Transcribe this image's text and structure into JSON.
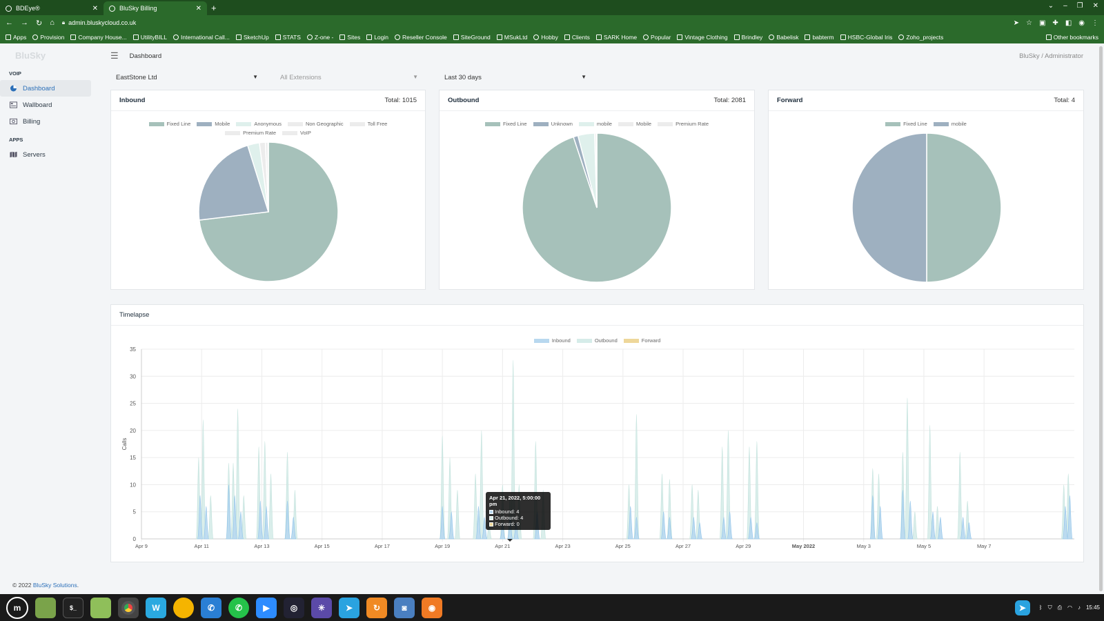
{
  "browser": {
    "tabs": [
      {
        "title": "BDEye®"
      },
      {
        "title": "BluSky Billing"
      }
    ],
    "address": "admin.bluskycloud.co.uk",
    "bookmarks": [
      "Apps",
      "Provision",
      "Company House...",
      "UtilityBILL",
      "International Call...",
      "SketchUp",
      "STATS",
      "Z-one -",
      "Sites",
      "Login",
      "Reseller Console",
      "SiteGround",
      "MSukLtd",
      "Hobby",
      "Clients",
      "SARK Home",
      "Popular",
      "Vintage Clothing",
      "Brindley",
      "Babelisk",
      "babterm",
      "HSBC-Global Iris",
      "Zoho_projects"
    ],
    "other_bookmarks": "Other bookmarks"
  },
  "sidebar": {
    "logo": "BluSky",
    "sections": [
      {
        "title": "VOIP",
        "items": [
          {
            "label": "Dashboard",
            "icon": "pie-chart-icon",
            "active": true
          },
          {
            "label": "Wallboard",
            "icon": "wallboard-icon",
            "active": false
          },
          {
            "label": "Billing",
            "icon": "billing-icon",
            "active": false
          }
        ]
      },
      {
        "title": "APPS",
        "items": [
          {
            "label": "Servers",
            "icon": "map-icon",
            "active": false
          }
        ]
      }
    ]
  },
  "header": {
    "breadcrumb": "Dashboard",
    "user": "BluSky / Administrator"
  },
  "filters": {
    "company": "EastStone Ltd",
    "extensions": "All Extensions",
    "period": "Last 30 days"
  },
  "cards": {
    "inbound": {
      "title": "Inbound",
      "total": "Total: 1015",
      "legend": [
        {
          "label": "Fixed Line",
          "color": "#a6c1ba"
        },
        {
          "label": "Mobile",
          "color": "#9eb0c0"
        },
        {
          "label": "Anonymous",
          "color": "#dff0ec"
        },
        {
          "label": "Non Geographic",
          "color": "#ececec"
        },
        {
          "label": "Toll Free",
          "color": "#ececec"
        },
        {
          "label": "Premium Rate",
          "color": "#ececec"
        },
        {
          "label": "VoIP",
          "color": "#ececec"
        }
      ]
    },
    "outbound": {
      "title": "Outbound",
      "total": "Total: 2081",
      "legend": [
        {
          "label": "Fixed Line",
          "color": "#a6c1ba"
        },
        {
          "label": "Unknown",
          "color": "#9eb0c0"
        },
        {
          "label": "mobile",
          "color": "#dff0ec"
        },
        {
          "label": "Mobile",
          "color": "#ececec"
        },
        {
          "label": "Premium Rate",
          "color": "#ececec"
        }
      ]
    },
    "forward": {
      "title": "Forward",
      "total": "Total: 4",
      "legend": [
        {
          "label": "Fixed Line",
          "color": "#a6c1ba"
        },
        {
          "label": "mobile",
          "color": "#9eb0c0"
        }
      ]
    }
  },
  "timelapse": {
    "title": "Timelapse",
    "legend": [
      {
        "label": "Inbound",
        "color": "#b8d8ef"
      },
      {
        "label": "Outbound",
        "color": "#d6ece9"
      },
      {
        "label": "Forward",
        "color": "#eed79a"
      }
    ],
    "tooltip": {
      "title": "Apr 21, 2022, 5:00:00 pm",
      "rows": [
        "Inbound: 4",
        "Outbound: 4",
        "Forward: 0"
      ]
    }
  },
  "chart_data": [
    {
      "type": "pie",
      "title": "Inbound",
      "labels": [
        "Fixed Line",
        "Mobile",
        "Anonymous",
        "Non Geographic",
        "Toll Free",
        "Premium Rate",
        "VoIP"
      ],
      "values": [
        742,
        224,
        28,
        14,
        6,
        1,
        0
      ]
    },
    {
      "type": "pie",
      "title": "Outbound",
      "labels": [
        "Fixed Line",
        "Unknown",
        "mobile",
        "Mobile",
        "Premium Rate"
      ],
      "values": [
        1975,
        21,
        75,
        8,
        2
      ]
    },
    {
      "type": "pie",
      "title": "Forward",
      "labels": [
        "Fixed Line",
        "mobile"
      ],
      "values": [
        2,
        2
      ]
    },
    {
      "type": "area",
      "title": "Timelapse",
      "ylabel": "Calls",
      "ylim": [
        0,
        35
      ],
      "yticks": [
        0,
        5,
        10,
        15,
        20,
        25,
        30,
        35
      ],
      "x_range": [
        "Apr 9",
        "May 9"
      ],
      "xticks": [
        {
          "label": "Apr 9",
          "day": 0,
          "bold": false
        },
        {
          "label": "Apr 11",
          "day": 2,
          "bold": false
        },
        {
          "label": "Apr 13",
          "day": 4,
          "bold": false
        },
        {
          "label": "Apr 15",
          "day": 6,
          "bold": false
        },
        {
          "label": "Apr 17",
          "day": 8,
          "bold": false
        },
        {
          "label": "Apr 19",
          "day": 10,
          "bold": false
        },
        {
          "label": "Apr 21",
          "day": 12,
          "bold": false
        },
        {
          "label": "Apr 23",
          "day": 14,
          "bold": false
        },
        {
          "label": "Apr 25",
          "day": 16,
          "bold": false
        },
        {
          "label": "Apr 27",
          "day": 18,
          "bold": false
        },
        {
          "label": "Apr 29",
          "day": 20,
          "bold": false
        },
        {
          "label": "May 2022",
          "day": 22,
          "bold": true
        },
        {
          "label": "May 3",
          "day": 24,
          "bold": false
        },
        {
          "label": "May 5",
          "day": 26,
          "bold": false
        },
        {
          "label": "May 7",
          "day": 28,
          "bold": false
        }
      ],
      "series": [
        {
          "name": "Outbound",
          "peaks": [
            [
              1.9,
              15
            ],
            [
              2.05,
              22
            ],
            [
              2.3,
              8
            ],
            [
              2.9,
              14
            ],
            [
              3.05,
              14
            ],
            [
              3.2,
              24
            ],
            [
              3.4,
              8
            ],
            [
              3.9,
              17
            ],
            [
              4.1,
              18
            ],
            [
              4.3,
              12
            ],
            [
              4.85,
              16
            ],
            [
              5.1,
              9
            ],
            [
              10.0,
              19
            ],
            [
              10.25,
              15
            ],
            [
              10.5,
              9
            ],
            [
              11.1,
              12
            ],
            [
              11.3,
              20
            ],
            [
              11.55,
              3
            ],
            [
              12.0,
              10
            ],
            [
              12.25,
              8
            ],
            [
              12.35,
              33
            ],
            [
              12.55,
              10
            ],
            [
              13.1,
              18
            ],
            [
              13.35,
              9
            ],
            [
              16.2,
              10
            ],
            [
              16.45,
              23
            ],
            [
              17.3,
              12
            ],
            [
              17.55,
              11
            ],
            [
              18.3,
              10
            ],
            [
              18.5,
              9
            ],
            [
              19.3,
              17
            ],
            [
              19.5,
              20
            ],
            [
              20.2,
              17
            ],
            [
              20.45,
              18
            ],
            [
              24.3,
              13
            ],
            [
              24.5,
              12
            ],
            [
              25.3,
              16
            ],
            [
              25.45,
              26
            ],
            [
              25.7,
              5
            ],
            [
              26.2,
              21
            ],
            [
              26.45,
              6
            ],
            [
              27.2,
              16
            ],
            [
              27.45,
              7
            ],
            [
              30.65,
              10
            ],
            [
              30.8,
              12
            ]
          ]
        },
        {
          "name": "Inbound",
          "peaks": [
            [
              1.95,
              8
            ],
            [
              2.15,
              6
            ],
            [
              2.9,
              10
            ],
            [
              3.1,
              8
            ],
            [
              3.3,
              5
            ],
            [
              3.95,
              7
            ],
            [
              4.15,
              6
            ],
            [
              4.85,
              7
            ],
            [
              5.05,
              4
            ],
            [
              10.0,
              6
            ],
            [
              10.3,
              5
            ],
            [
              11.2,
              6
            ],
            [
              11.4,
              4
            ],
            [
              12.0,
              3
            ],
            [
              12.25,
              4
            ],
            [
              12.45,
              3
            ],
            [
              13.15,
              5
            ],
            [
              16.25,
              6
            ],
            [
              16.45,
              4
            ],
            [
              17.35,
              5
            ],
            [
              17.55,
              4
            ],
            [
              18.35,
              4
            ],
            [
              18.55,
              3
            ],
            [
              19.35,
              4
            ],
            [
              19.55,
              5
            ],
            [
              20.25,
              4
            ],
            [
              20.45,
              3
            ],
            [
              24.3,
              8
            ],
            [
              24.55,
              6
            ],
            [
              25.3,
              9
            ],
            [
              25.55,
              7
            ],
            [
              26.3,
              5
            ],
            [
              26.55,
              4
            ],
            [
              27.3,
              4
            ],
            [
              27.5,
              3
            ],
            [
              30.7,
              6
            ],
            [
              30.85,
              8
            ]
          ]
        },
        {
          "name": "Forward",
          "peaks": []
        }
      ]
    }
  ]
}
